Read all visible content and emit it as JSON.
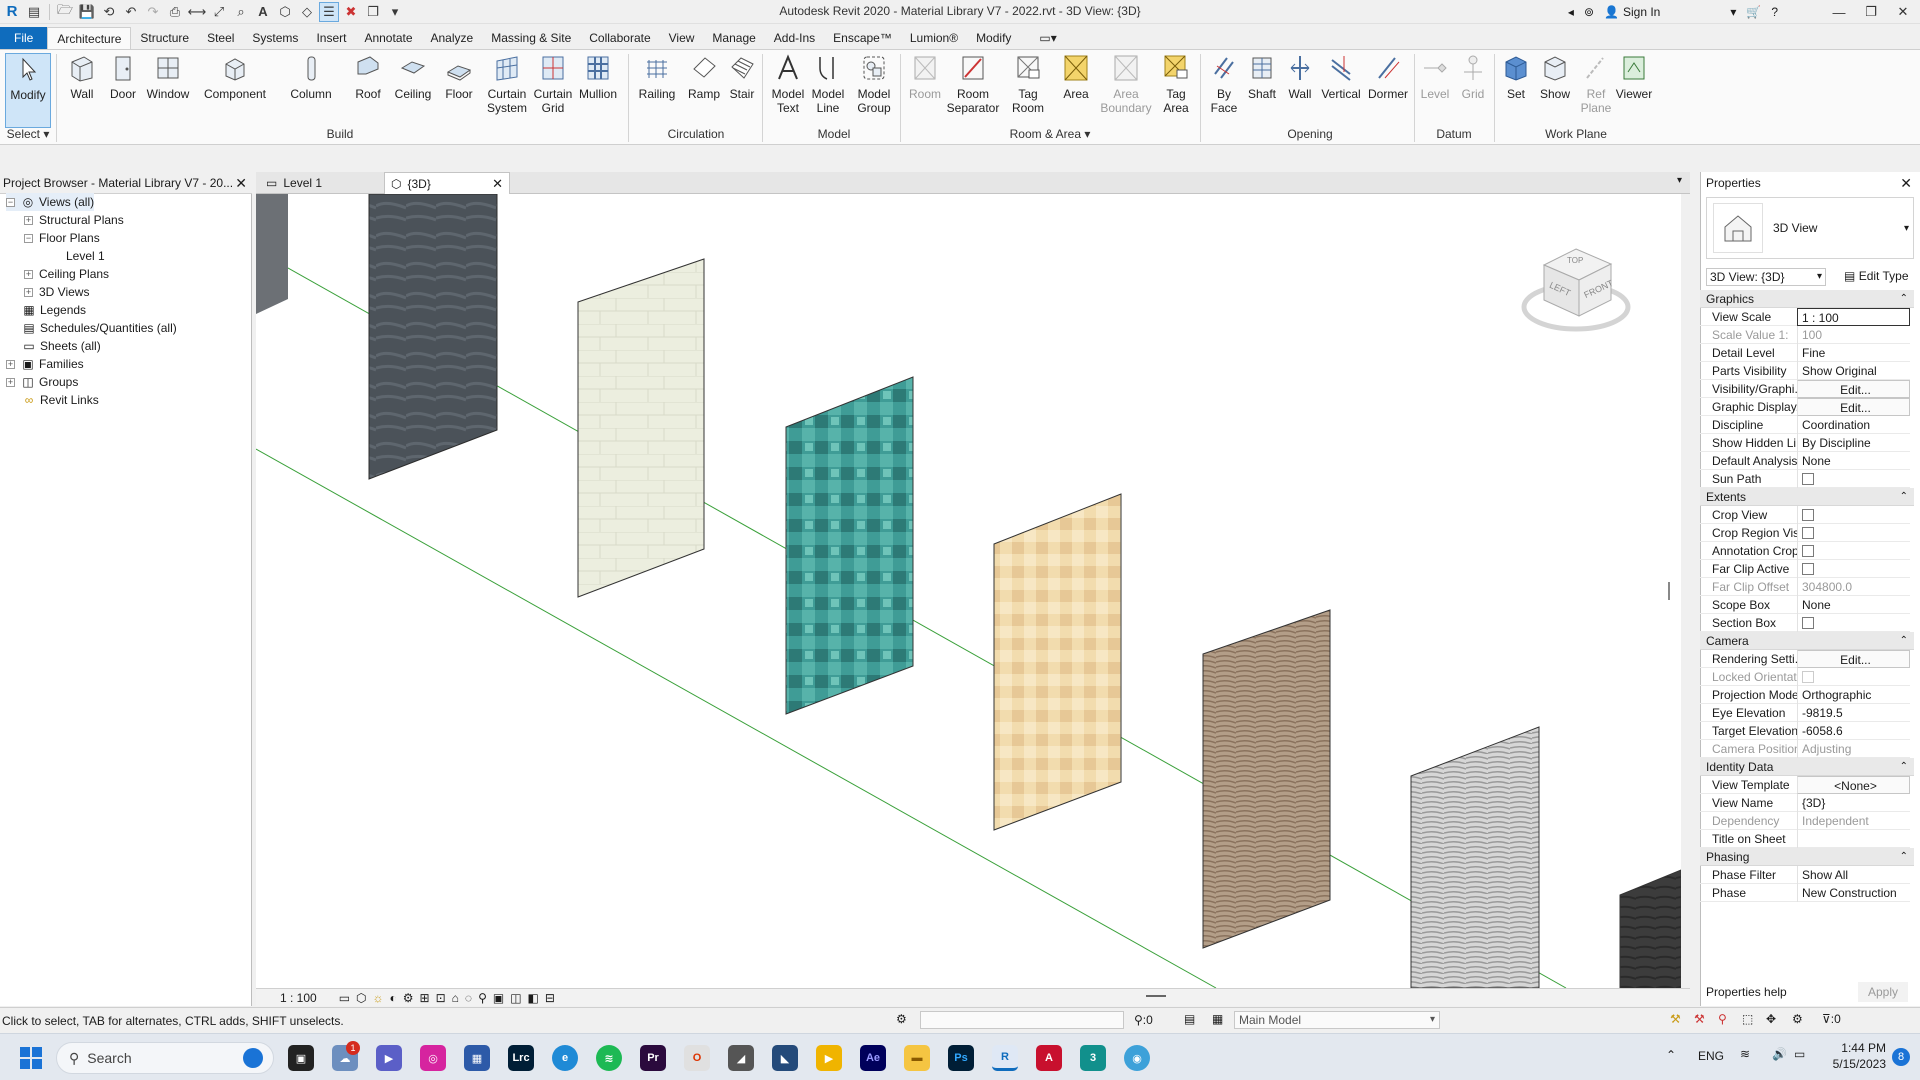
{
  "window": {
    "title": "Autodesk Revit 2020 - Material Library V7 - 2022.rvt - 3D View: {3D}",
    "sign_in": "Sign In"
  },
  "menu_tabs": [
    "File",
    "Architecture",
    "Structure",
    "Steel",
    "Systems",
    "Insert",
    "Annotate",
    "Analyze",
    "Massing & Site",
    "Collaborate",
    "View",
    "Manage",
    "Add-Ins",
    "Enscape™",
    "Lumion®",
    "Modify"
  ],
  "ribbon": {
    "buttons": [
      {
        "label": "Modify",
        "icon": "cursor-arrow-icon"
      },
      {
        "label": "Wall",
        "icon": "wall-icon"
      },
      {
        "label": "Door",
        "icon": "door-icon"
      },
      {
        "label": "Window",
        "icon": "window-icon"
      },
      {
        "label": "Component",
        "icon": "component-icon"
      },
      {
        "label": "Column",
        "icon": "column-icon"
      },
      {
        "label": "Roof",
        "icon": "roof-icon"
      },
      {
        "label": "Ceiling",
        "icon": "ceiling-icon"
      },
      {
        "label": "Floor",
        "icon": "floor-icon"
      },
      {
        "label": "Curtain\nSystem",
        "icon": "curtain-system-icon"
      },
      {
        "label": "Curtain\nGrid",
        "icon": "curtain-grid-icon"
      },
      {
        "label": "Mullion",
        "icon": "mullion-icon"
      },
      {
        "label": "Railing",
        "icon": "railing-icon"
      },
      {
        "label": "Ramp",
        "icon": "ramp-icon"
      },
      {
        "label": "Stair",
        "icon": "stair-icon"
      },
      {
        "label": "Model\nText",
        "icon": "model-text-icon"
      },
      {
        "label": "Model\nLine",
        "icon": "model-line-icon"
      },
      {
        "label": "Model\nGroup",
        "icon": "model-group-icon"
      },
      {
        "label": "Room",
        "icon": "room-icon"
      },
      {
        "label": "Room\nSeparator",
        "icon": "room-separator-icon"
      },
      {
        "label": "Tag\nRoom",
        "icon": "tag-room-icon"
      },
      {
        "label": "Area",
        "icon": "area-icon"
      },
      {
        "label": "Area\nBoundary",
        "icon": "area-boundary-icon"
      },
      {
        "label": "Tag\nArea",
        "icon": "tag-area-icon"
      },
      {
        "label": "By\nFace",
        "icon": "by-face-icon"
      },
      {
        "label": "Shaft",
        "icon": "shaft-icon"
      },
      {
        "label": "Wall",
        "icon": "wall-opening-icon"
      },
      {
        "label": "Vertical",
        "icon": "vertical-icon"
      },
      {
        "label": "Dormer",
        "icon": "dormer-icon"
      },
      {
        "label": "Level",
        "icon": "level-icon"
      },
      {
        "label": "Grid",
        "icon": "grid-icon"
      },
      {
        "label": "Set",
        "icon": "set-icon"
      },
      {
        "label": "Show",
        "icon": "show-icon"
      },
      {
        "label": "Ref\nPlane",
        "icon": "ref-plane-icon"
      },
      {
        "label": "Viewer",
        "icon": "viewer-icon"
      }
    ],
    "panels": [
      "Select",
      "Build",
      "Circulation",
      "Model",
      "Room & Area",
      "Opening",
      "Datum",
      "Work Plane"
    ]
  },
  "project_browser": {
    "title": "Project Browser - Material Library V7 - 20...",
    "items": [
      "Views (all)",
      "Structural Plans",
      "Floor Plans",
      "Level 1",
      "Ceiling Plans",
      "3D Views",
      "Legends",
      "Schedules/Quantities (all)",
      "Sheets (all)",
      "Families",
      "Groups",
      "Revit Links"
    ]
  },
  "view_tabs": [
    "Level 1",
    "{3D}"
  ],
  "viewcube": {
    "top": "TOP",
    "left": "LEFT",
    "front": "FRONT"
  },
  "view_scale": "1 : 100",
  "properties": {
    "title": "Properties",
    "type_name": "3D View",
    "selector": "3D View: {3D}",
    "edit_type": "Edit Type",
    "groups": [
      {
        "name": "Graphics",
        "rows": [
          {
            "name": "View Scale",
            "value": "1 : 100"
          },
          {
            "name": "Scale Value  1:",
            "value": "100"
          },
          {
            "name": "Detail Level",
            "value": "Fine"
          },
          {
            "name": "Parts Visibility",
            "value": "Show Original"
          },
          {
            "name": "Visibility/Graphi...",
            "value": "Edit..."
          },
          {
            "name": "Graphic Display...",
            "value": "Edit..."
          },
          {
            "name": "Discipline",
            "value": "Coordination"
          },
          {
            "name": "Show Hidden Li...",
            "value": "By Discipline"
          },
          {
            "name": "Default Analysis...",
            "value": "None"
          },
          {
            "name": "Sun Path",
            "value": ""
          }
        ]
      },
      {
        "name": "Extents",
        "rows": [
          {
            "name": "Crop View",
            "value": ""
          },
          {
            "name": "Crop Region Vis...",
            "value": ""
          },
          {
            "name": "Annotation Crop",
            "value": ""
          },
          {
            "name": "Far Clip Active",
            "value": ""
          },
          {
            "name": "Far Clip Offset",
            "value": "304800.0"
          },
          {
            "name": "Scope Box",
            "value": "None"
          },
          {
            "name": "Section Box",
            "value": ""
          }
        ]
      },
      {
        "name": "Camera",
        "rows": [
          {
            "name": "Rendering Setti...",
            "value": "Edit..."
          },
          {
            "name": "Locked Orientat...",
            "value": ""
          },
          {
            "name": "Projection Mode",
            "value": "Orthographic"
          },
          {
            "name": "Eye Elevation",
            "value": "-9819.5"
          },
          {
            "name": "Target Elevation",
            "value": "-6058.6"
          },
          {
            "name": "Camera Position",
            "value": "Adjusting"
          }
        ]
      },
      {
        "name": "Identity Data",
        "rows": [
          {
            "name": "View Template",
            "value": "<None>"
          },
          {
            "name": "View Name",
            "value": "{3D}"
          },
          {
            "name": "Dependency",
            "value": "Independent"
          },
          {
            "name": "Title on Sheet",
            "value": ""
          }
        ]
      },
      {
        "name": "Phasing",
        "rows": [
          {
            "name": "Phase Filter",
            "value": "Show All"
          },
          {
            "name": "Phase",
            "value": "New Construction"
          }
        ]
      }
    ],
    "help_link": "Properties help",
    "apply": "Apply"
  },
  "status": {
    "hint": "Click to select, TAB for alternates, CTRL adds, SHIFT unselects.",
    "selection_count": ":0",
    "model": "Main Model",
    "filter_count": ":0"
  },
  "taskbar": {
    "search_placeholder": "Search",
    "language": "ENG",
    "time": "1:44 PM",
    "date": "5/15/2023",
    "notification_count": "8",
    "badge": "1"
  }
}
